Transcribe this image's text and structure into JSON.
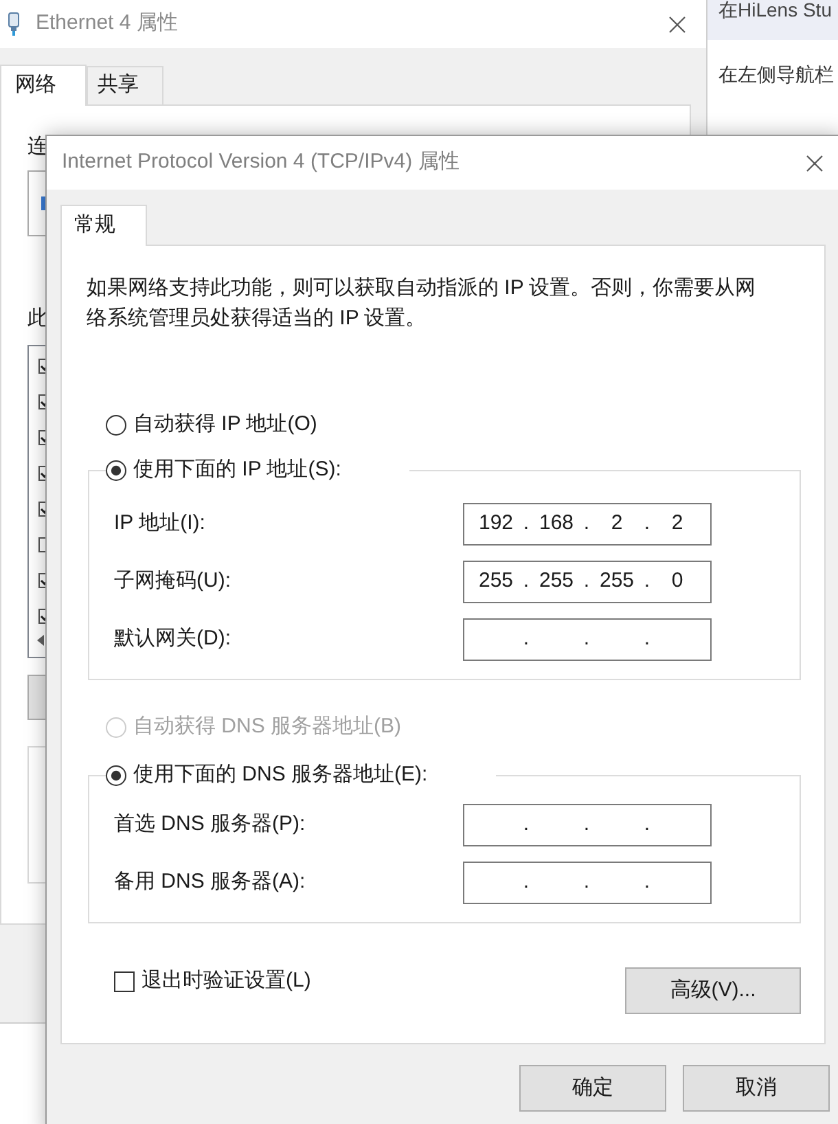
{
  "web_page": {
    "header_text": "在HiLens Stu",
    "body_text": "在左侧导航栏"
  },
  "background_window": {
    "title": "Ethernet 4 属性",
    "tabs": [
      {
        "label": "网络",
        "selected": true
      },
      {
        "label": "共享",
        "selected": false
      }
    ],
    "cut_labels": [
      "连",
      "此"
    ],
    "list_items": [
      {
        "checked": true
      },
      {
        "checked": true
      },
      {
        "checked": true
      },
      {
        "checked": true
      },
      {
        "checked": true
      },
      {
        "checked": false
      },
      {
        "checked": true
      },
      {
        "checked": true
      }
    ]
  },
  "dialog": {
    "title": "Internet Protocol Version 4 (TCP/IPv4) 属性",
    "tabs": [
      {
        "label": "常规",
        "selected": true
      }
    ],
    "description": "如果网络支持此功能，则可以获取自动指派的 IP 设置。否则，你需要从网络系统管理员处获得适当的 IP 设置。",
    "ip_section": {
      "auto_option": {
        "label": "自动获得 IP 地址(O)",
        "selected": false,
        "disabled": false
      },
      "manual_option": {
        "label": "使用下面的 IP 地址(S):",
        "selected": true,
        "disabled": false
      },
      "fields": [
        {
          "label": "IP 地址(I):",
          "octets": [
            "192",
            "168",
            "2",
            "2"
          ],
          "dots": [
            ".",
            ".",
            "."
          ]
        },
        {
          "label": "子网掩码(U):",
          "octets": [
            "255",
            "255",
            "255",
            "0"
          ],
          "dots": [
            ".",
            ".",
            "."
          ]
        },
        {
          "label": "默认网关(D):",
          "dots": [
            ".",
            ".",
            "."
          ]
        }
      ]
    },
    "dns_section": {
      "auto_option": {
        "label": "自动获得 DNS 服务器地址(B)",
        "selected": false,
        "disabled": true
      },
      "manual_option": {
        "label": "使用下面的 DNS 服务器地址(E):",
        "selected": true,
        "disabled": false
      },
      "fields": [
        {
          "label": "首选 DNS 服务器(P):",
          "dots": [
            ".",
            ".",
            "."
          ]
        },
        {
          "label": "备用 DNS 服务器(A):",
          "dots": [
            ".",
            ".",
            "."
          ]
        }
      ]
    },
    "validate_on_exit": {
      "label": "退出时验证设置(L)",
      "checked": false
    },
    "advanced_button": "高级(V)...",
    "buttons": [
      "确定",
      "取消"
    ]
  }
}
